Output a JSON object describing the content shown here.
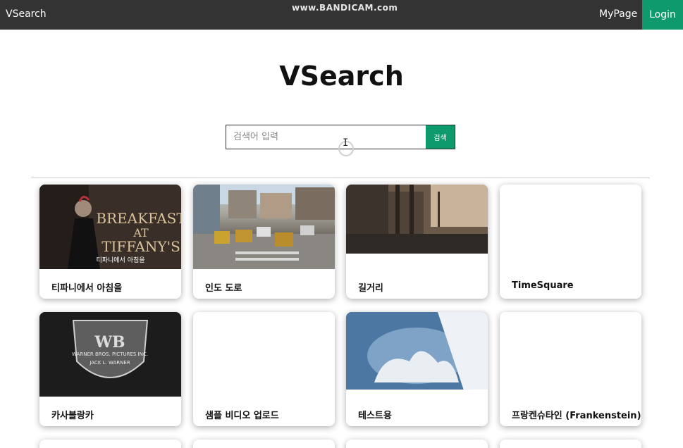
{
  "nav": {
    "brand": "VSearch",
    "watermark": "www.BANDICAM.com",
    "mypage": "MyPage",
    "login": "Login"
  },
  "hero": {
    "title": "VSearch"
  },
  "search": {
    "placeholder": "검색어 입력",
    "button": "검색"
  },
  "cards": [
    {
      "title": "티파니에서 아침을",
      "thumb_text": "BREAKFAST\nAT\nTIFFANY'S",
      "thumb_caption": "티파니에서 아침을"
    },
    {
      "title": "인도 도로"
    },
    {
      "title": "길거리"
    },
    {
      "title": "TimeSquare"
    },
    {
      "title": "카사블랑카",
      "thumb_text": "WARNER BROS. PICTURES INC.",
      "thumb_caption": "JACK L. WARNER"
    },
    {
      "title": "샘플 비디오 업로드"
    },
    {
      "title": "테스트용"
    },
    {
      "title": "프랑켄슈타인 (Frankenstein)"
    }
  ],
  "colors": {
    "topbar": "#333333",
    "accent": "#0e9a6c"
  }
}
